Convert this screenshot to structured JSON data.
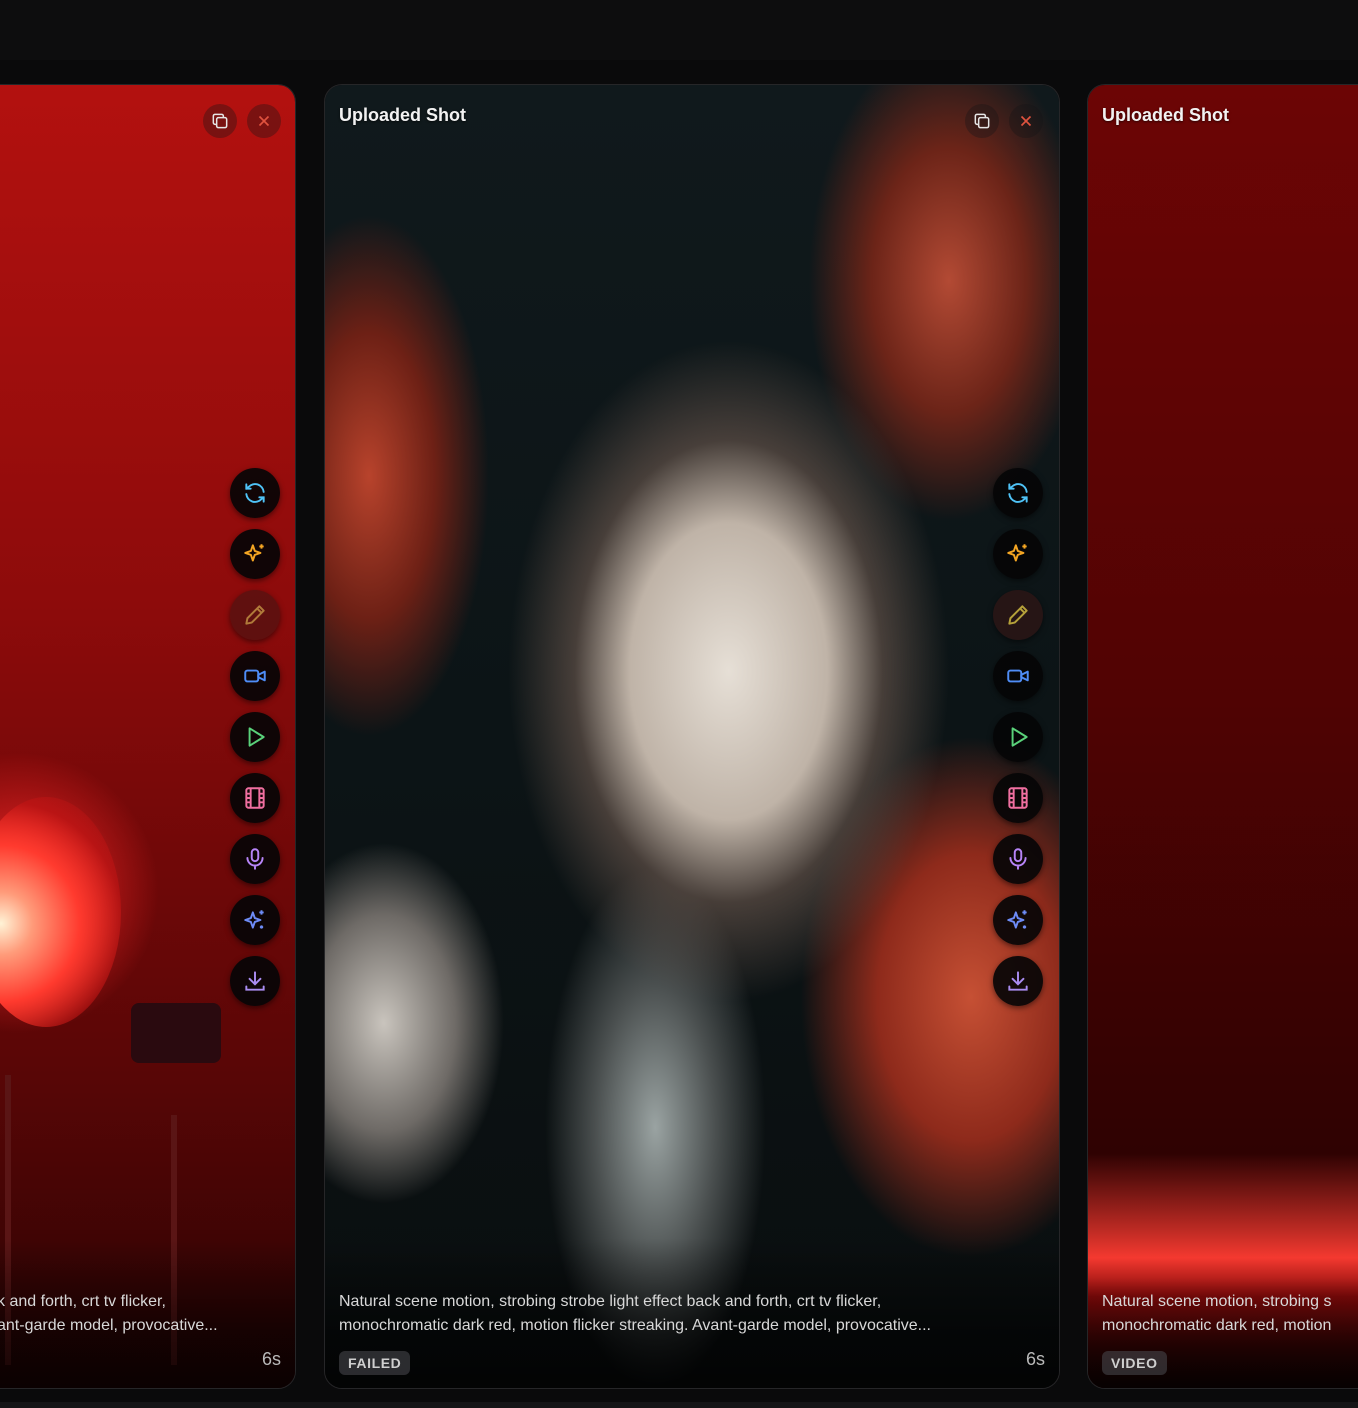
{
  "cards": [
    {
      "title": "",
      "caption_line1": "k and forth, crt tv flicker,",
      "caption_line2": "ant-garde model, provocative...",
      "badge": "",
      "duration": "6s"
    },
    {
      "title": "Uploaded Shot",
      "caption_line1": "Natural scene motion, strobing strobe light effect back and forth, crt tv flicker,",
      "caption_line2": "monochromatic dark red, motion flicker streaking. Avant-garde model, provocative...",
      "badge": "FAILED",
      "duration": "6s"
    },
    {
      "title": "Uploaded Shot",
      "caption_line1": "Natural scene motion, strobing s",
      "caption_line2": "monochromatic dark red, motion",
      "badge": "VIDEO",
      "duration": ""
    }
  ],
  "icons": {
    "duplicate": "duplicate-icon",
    "close": "close-icon",
    "actions": [
      "refresh-icon",
      "sparkle-icon",
      "pencil-icon",
      "video-camera-icon",
      "play-icon",
      "film-icon",
      "microphone-icon",
      "magic-sparkle-icon",
      "download-icon"
    ]
  },
  "colors": {
    "refresh": "#4fc3f7",
    "sparkle": "#f5a623",
    "pencil": "#b07a3a",
    "camera": "#4f8df7",
    "play": "#5ad17a",
    "film": "#f06fa0",
    "mic": "#b784f7",
    "magic": "#6e8cf7",
    "download": "#a98cf0",
    "close": "#e0533f"
  }
}
